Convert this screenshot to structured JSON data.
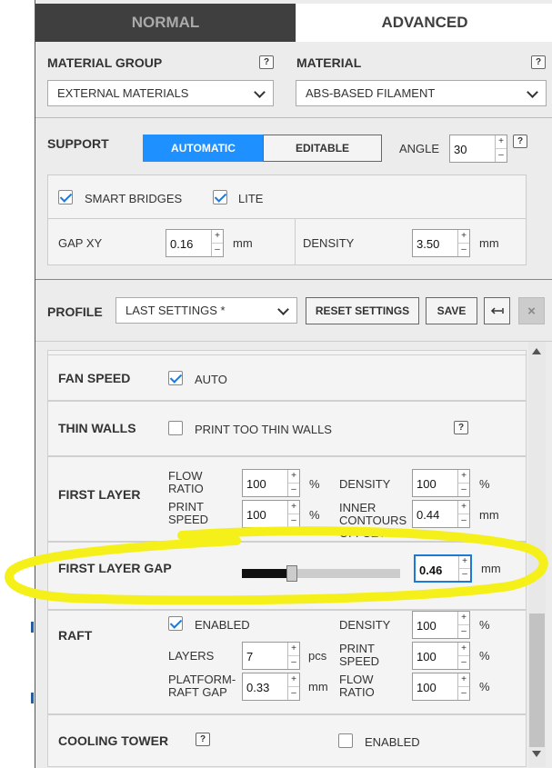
{
  "tabs": {
    "normal": "NORMAL",
    "advanced": "ADVANCED"
  },
  "material": {
    "group_label": "MATERIAL GROUP",
    "group_value": "EXTERNAL MATERIALS",
    "material_label": "MATERIAL",
    "material_value": "ABS-BASED FILAMENT",
    "help": "?"
  },
  "support": {
    "title": "SUPPORT",
    "automatic": "AUTOMATIC",
    "editable": "EDITABLE",
    "angle_label": "ANGLE",
    "angle_value": "30",
    "smart_bridges": "SMART BRIDGES",
    "smart_bridges_checked": true,
    "lite": "LITE",
    "lite_checked": true,
    "gap_xy_label": "GAP XY",
    "gap_xy_value": "0.16",
    "gap_xy_unit": "mm",
    "density_label": "DENSITY",
    "density_value": "3.50",
    "density_unit": "mm"
  },
  "profile": {
    "title": "PROFILE",
    "value": "LAST SETTINGS *",
    "reset": "RESET SETTINGS",
    "save": "SAVE",
    "close": "×"
  },
  "settings": {
    "fan_speed": "FAN SPEED",
    "fan_auto": "AUTO",
    "fan_auto_checked": true,
    "thin_walls": "THIN WALLS",
    "thin_walls_option": "PRINT TOO THIN WALLS",
    "thin_walls_checked": false,
    "first_layer": "FIRST LAYER",
    "flow_ratio_label": "FLOW RATIO",
    "flow_ratio_value": "100",
    "flow_ratio_unit": "%",
    "print_speed_label": "PRINT SPEED",
    "print_speed_value": "100",
    "print_speed_unit": "%",
    "fl_density_label": "DENSITY",
    "fl_density_value": "100",
    "fl_density_unit": "%",
    "inner_offset_label": "INNER CONTOURS OFFSET",
    "inner_offset_value": "0.44",
    "inner_offset_unit": "mm",
    "first_layer_gap": "FIRST LAYER GAP",
    "first_layer_gap_value": "0.46",
    "first_layer_gap_unit": "mm",
    "first_layer_gap_slider": 0.07,
    "raft": "RAFT",
    "raft_enabled": "ENABLED",
    "raft_enabled_checked": true,
    "raft_density_label": "DENSITY",
    "raft_density_value": "100",
    "raft_density_unit": "%",
    "layers_label": "LAYERS",
    "layers_value": "7",
    "layers_unit": "pcs",
    "raft_speed_label": "PRINT SPEED",
    "raft_speed_value": "100",
    "raft_speed_unit": "%",
    "platform_gap_label": "PLATFORM-RAFT GAP",
    "platform_gap_value": "0.33",
    "platform_gap_unit": "mm",
    "raft_flow_label": "FLOW RATIO",
    "raft_flow_value": "100",
    "raft_flow_unit": "%",
    "cooling_tower": "COOLING TOWER",
    "cooling_enabled": "ENABLED",
    "cooling_enabled_checked": false
  },
  "colors": {
    "accent": "#1e90ff",
    "highlight": "#f5f01a"
  }
}
